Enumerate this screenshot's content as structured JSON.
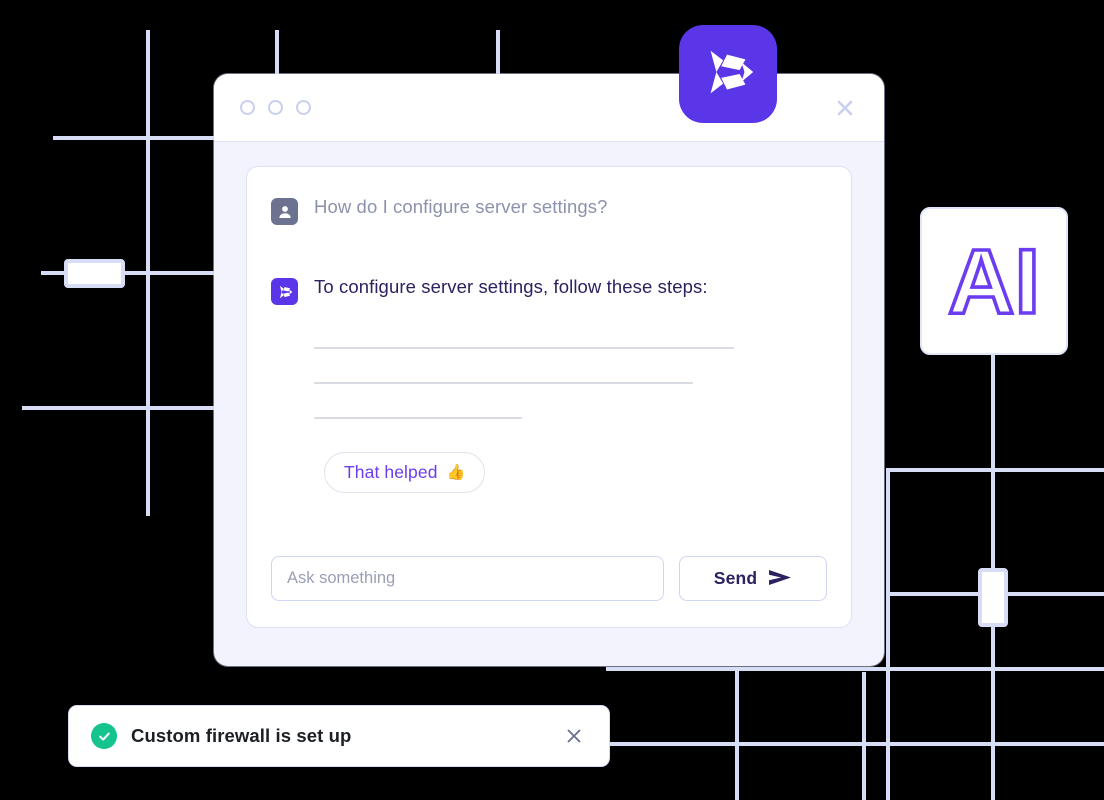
{
  "window": {
    "title_dots": [
      "dot-1",
      "dot-2",
      "dot-3"
    ],
    "close_label": "×"
  },
  "brand": {
    "logo_icon": "app-logo-icon",
    "accent_color": "#5B36E8"
  },
  "conversation": {
    "messages": [
      {
        "role": "user",
        "avatar_icon": "user-avatar-icon",
        "text": "How do I configure server settings?"
      },
      {
        "role": "assistant",
        "avatar_icon": "assistant-logo-icon",
        "text": "To configure server settings, follow these steps:"
      }
    ],
    "placeholder_lines": [
      420,
      379,
      208
    ]
  },
  "feedback": {
    "label": "That helped",
    "emoji": "👍"
  },
  "composer": {
    "input_value": "",
    "placeholder": "Ask something",
    "send_label": "Send",
    "send_icon": "send-arrow-icon"
  },
  "ai_card": {
    "label": "AI",
    "stroke_color": "#6B3CF0"
  },
  "toast": {
    "status_icon": "success-check-icon",
    "message": "Custom firewall is set up",
    "close_icon": "close-icon",
    "success_color": "#14C38E"
  },
  "background": {
    "line_color": "#D8DDF6",
    "node_fill": "#FFFFFF"
  }
}
